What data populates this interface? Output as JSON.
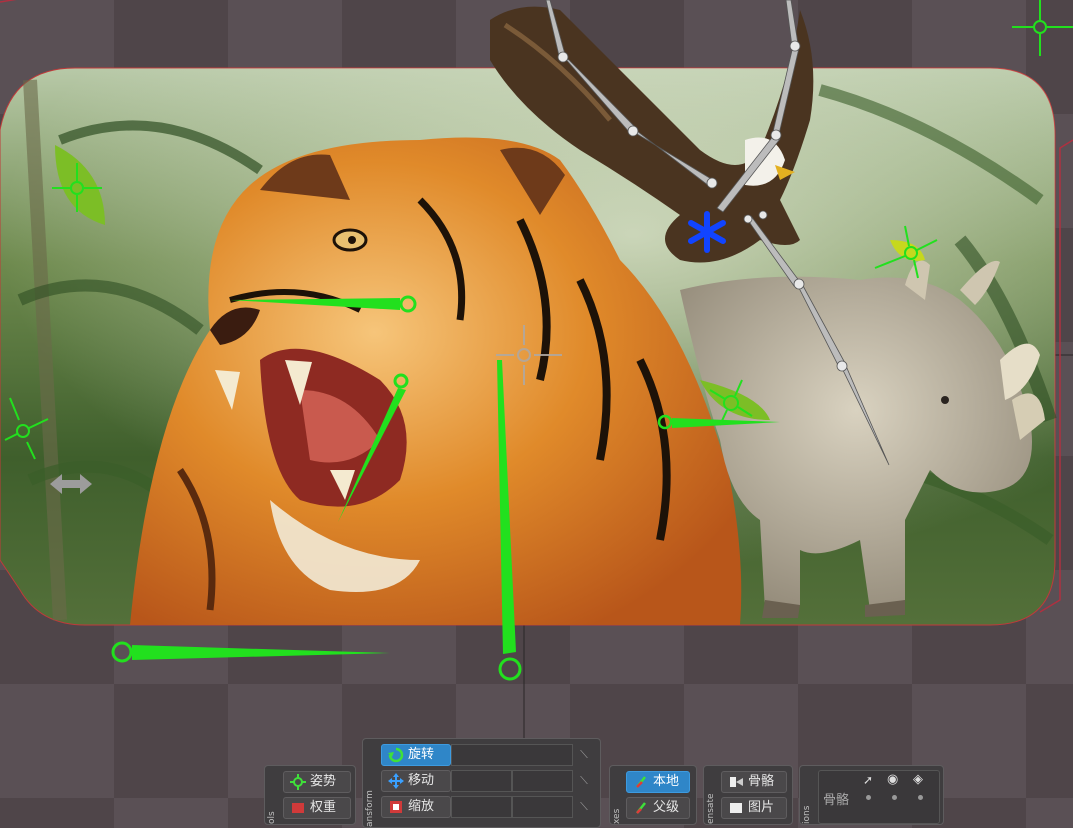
{
  "toolbars": {
    "tools": {
      "title": "ols",
      "buttons": [
        {
          "label": "姿势",
          "icon": "pose-icon",
          "active": false
        },
        {
          "label": "权重",
          "icon": "weights-icon",
          "active": false
        }
      ]
    },
    "transform": {
      "title": "ansform",
      "buttons": [
        {
          "label": "旋转",
          "icon": "rotate-icon",
          "active": true
        },
        {
          "label": "移动",
          "icon": "move-icon",
          "active": false
        },
        {
          "label": "缩放",
          "icon": "scale-icon",
          "active": false
        }
      ]
    },
    "axes": {
      "title": "xes",
      "buttons": [
        {
          "label": "本地",
          "icon": "local-axis-icon",
          "active": true
        },
        {
          "label": "父级",
          "icon": "parent-axis-icon",
          "active": false
        }
      ]
    },
    "compensate": {
      "title": "ensate",
      "buttons": [
        {
          "label": "骨骼",
          "icon": "bone-compensate-icon",
          "active": false
        },
        {
          "label": "图片",
          "icon": "image-compensate-icon",
          "active": false
        }
      ]
    },
    "options": {
      "title": "ions",
      "row_label": "骨骼"
    }
  },
  "colors": {
    "accent": "#2f86c8",
    "bone_green": "#22e01e",
    "ik_blue": "#1144ff",
    "background_checker": "#5a5055"
  }
}
